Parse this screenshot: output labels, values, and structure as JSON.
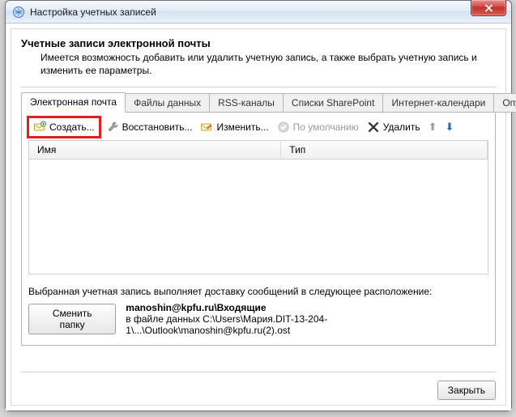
{
  "window": {
    "title": "Настройка учетных записей"
  },
  "header": {
    "title": "Учетные записи электронной почты",
    "desc": "Имеется возможность добавить или удалить учетную запись, а также выбрать учетную запись и изменить ее параметры."
  },
  "tabs": [
    {
      "label": "Электронная почта",
      "active": true
    },
    {
      "label": "Файлы данных"
    },
    {
      "label": "RSS-каналы"
    },
    {
      "label": "Списки SharePoint"
    },
    {
      "label": "Интернет-календари"
    },
    {
      "label": "Опубликован"
    }
  ],
  "toolbar": {
    "create": "Создать...",
    "repair": "Восстановить...",
    "edit": "Изменить...",
    "default": "По умолчанию",
    "delete": "Удалить"
  },
  "list": {
    "columns": {
      "name": "Имя",
      "type": "Тип"
    },
    "rows": []
  },
  "delivery": {
    "text": "Выбранная учетная запись выполняет доставку сообщений в следующее расположение:",
    "change_btn": "Сменить папку",
    "folder": "manoshin@kpfu.ru\\Входящие",
    "file": "в файле данных C:\\Users\\Мария.DIT-13-204-1\\...\\Outlook\\manoshin@kpfu.ru(2).ost"
  },
  "footer": {
    "close": "Закрыть"
  }
}
